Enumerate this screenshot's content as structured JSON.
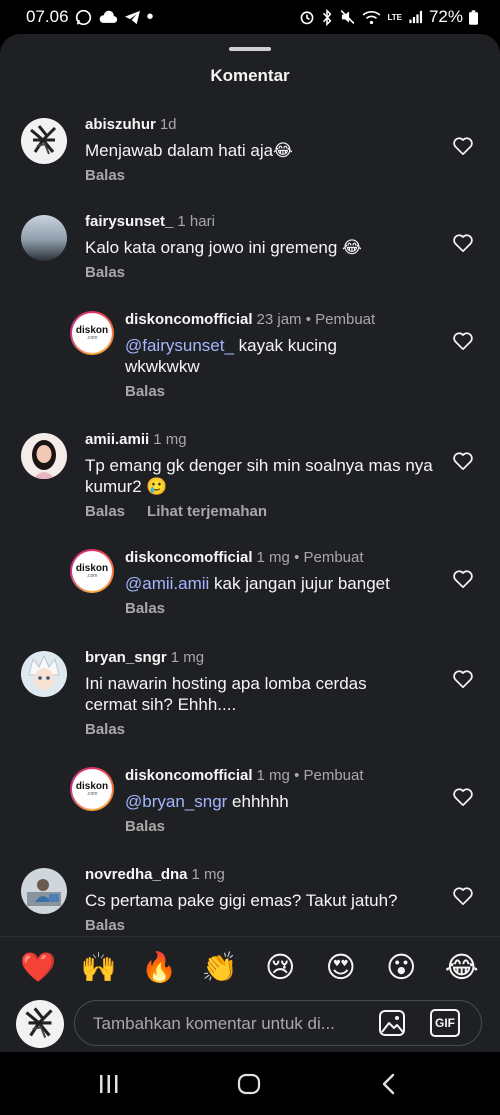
{
  "status_bar": {
    "time": "07.06",
    "battery": "72%",
    "network": "LTE"
  },
  "sheet": {
    "title": "Komentar"
  },
  "comments": [
    {
      "user": "abiszuhur",
      "time": "1d",
      "text": "Menjawab dalam hati aja😂",
      "reply": "Balas"
    },
    {
      "user": "fairysunset_",
      "time": "1 hari",
      "text": "Kalo kata orang jowo ini gremeng 😂",
      "reply": "Balas"
    },
    {
      "user": "diskoncomofficial",
      "time": "23 jam",
      "creator": "• Pembuat",
      "mention": "@fairysunset_",
      "text": " kayak kucing wkwkwkw",
      "reply": "Balas"
    },
    {
      "user": "amii.amii",
      "time": "1 mg",
      "text": "Tp emang gk denger sih min soalnya mas nya kumur2 🥲",
      "reply": "Balas",
      "translate": "Lihat terjemahan"
    },
    {
      "user": "diskoncomofficial",
      "time": "1 mg",
      "creator": "• Pembuat",
      "mention": "@amii.amii",
      "text": " kak jangan jujur banget",
      "reply": "Balas"
    },
    {
      "user": "bryan_sngr",
      "time": "1 mg",
      "text": "Ini nawarin hosting apa lomba cerdas cermat sih? Ehhh....",
      "reply": "Balas"
    },
    {
      "user": "diskoncomofficial",
      "time": "1 mg",
      "creator": "• Pembuat",
      "mention": "@bryan_sngr",
      "text": " ehhhhh",
      "reply": "Balas"
    },
    {
      "user": "novredha_dna",
      "time": "1 mg",
      "text": "Cs pertama pake gigi emas? Takut jatuh?",
      "reply": "Balas"
    }
  ],
  "reactions": [
    "❤️",
    "🙌",
    "🔥",
    "👏",
    "😢",
    "😍",
    "😮",
    "😂"
  ],
  "composer": {
    "placeholder": "Tambahkan komentar untuk di...",
    "gif_label": "GIF"
  },
  "brand": {
    "logo_text": "diskon",
    "logo_sub": ".com",
    "accent": "#a3b6ff",
    "sheet_bg": "#1e2023"
  }
}
